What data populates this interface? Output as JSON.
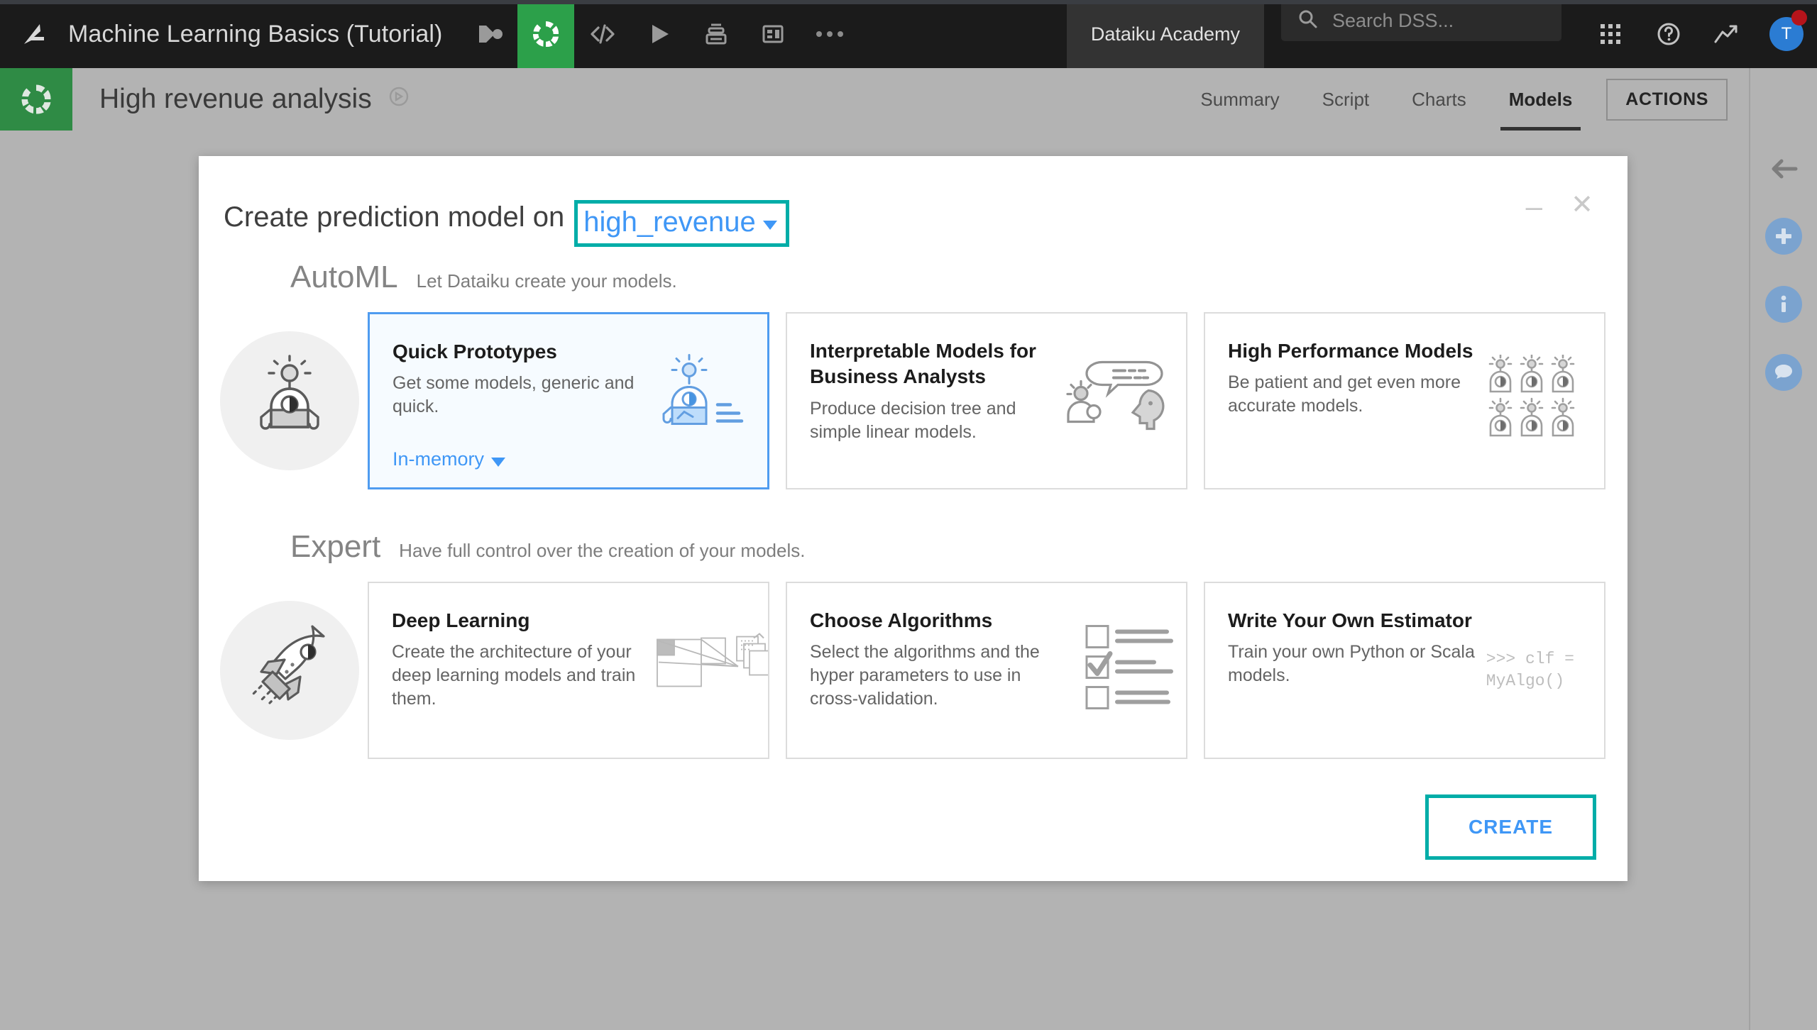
{
  "topbar": {
    "logo_icon": "dataiku-bird-logo",
    "project_title": "Machine Learning Basics (Tutorial)",
    "icons": [
      {
        "name": "flow-icon",
        "glyph": "flow"
      },
      {
        "name": "lab-icon",
        "glyph": "lab",
        "active": true
      },
      {
        "name": "code-icon",
        "glyph": "code"
      },
      {
        "name": "jobs-run-icon",
        "glyph": "play"
      },
      {
        "name": "automation-icon",
        "glyph": "stack"
      },
      {
        "name": "dashboard-icon",
        "glyph": "dashboard"
      },
      {
        "name": "more-icon",
        "glyph": "ellipsis"
      }
    ],
    "academy_label": "Dataiku Academy",
    "search": {
      "placeholder": "Search DSS...",
      "value": "",
      "icon": "search-icon"
    },
    "right_icons": [
      {
        "name": "apps-grid-icon"
      },
      {
        "name": "help-icon"
      },
      {
        "name": "activity-trend-icon"
      }
    ],
    "avatar_initial": "T",
    "avatar_color": "#2b7cd3",
    "notification_color": "#b5141b"
  },
  "subheader": {
    "logo_icon": "lab-analysis-icon",
    "title": "High revenue analysis",
    "title_badge_icon": "discussion-compass-icon",
    "tabs": [
      {
        "label": "Summary",
        "active": false
      },
      {
        "label": "Script",
        "active": false
      },
      {
        "label": "Charts",
        "active": false
      },
      {
        "label": "Models",
        "active": true
      }
    ],
    "actions_label": "ACTIONS",
    "collapse_icon": "back-arrow-icon"
  },
  "rightrail": {
    "items": [
      {
        "name": "back-arrow-icon",
        "kind": "arrow"
      },
      {
        "name": "add-icon",
        "kind": "circle",
        "glyph": "+"
      },
      {
        "name": "info-icon",
        "kind": "circle",
        "glyph": "i"
      },
      {
        "name": "discussions-icon",
        "kind": "circle",
        "glyph": "chat"
      }
    ],
    "circle_color": "#7ba3cf"
  },
  "modal": {
    "title_prefix": "Create prediction model on",
    "target_variable": "high_revenue",
    "highlight_color": "#00ada8",
    "minimize_label": "–",
    "close_label": "✕",
    "create_label": "CREATE",
    "sections": [
      {
        "title": "AutoML",
        "subtitle": "Let Dataiku create your models.",
        "badge_icon": "robot-icon",
        "cards": [
          {
            "title": "Quick Prototypes",
            "description": "Get some models, generic and quick.",
            "option_label": "In-memory",
            "art": "robot-lightbulb-icon",
            "selected": true
          },
          {
            "title": "Interpretable Models for Business Analysts",
            "description": "Produce decision tree and simple linear models.",
            "option_label": "",
            "art": "conversation-heads-icon",
            "selected": false
          },
          {
            "title": "High Performance Models",
            "description": "Be patient and get even more accurate models.",
            "option_label": "",
            "art": "robot-grid-icon",
            "selected": false
          }
        ]
      },
      {
        "title": "Expert",
        "subtitle": "Have full control over the creation of your models.",
        "badge_icon": "rocket-icon",
        "cards": [
          {
            "title": "Deep Learning",
            "description": "Create the architecture of your deep learning models and train them.",
            "option_label": "",
            "art": "neural-layers-icon",
            "selected": false
          },
          {
            "title": "Choose Algorithms",
            "description": "Select the algorithms and the hyper parameters to use in cross-validation.",
            "option_label": "",
            "art": "checkbox-list-icon",
            "selected": false
          },
          {
            "title": "Write Your Own Estimator",
            "description": "Train your own Python or Scala models.",
            "option_label": "",
            "art": "code-snippet-icon",
            "code_line1": ">>> clf =",
            "code_line2": "MyAlgo()",
            "selected": false
          }
        ]
      }
    ]
  }
}
